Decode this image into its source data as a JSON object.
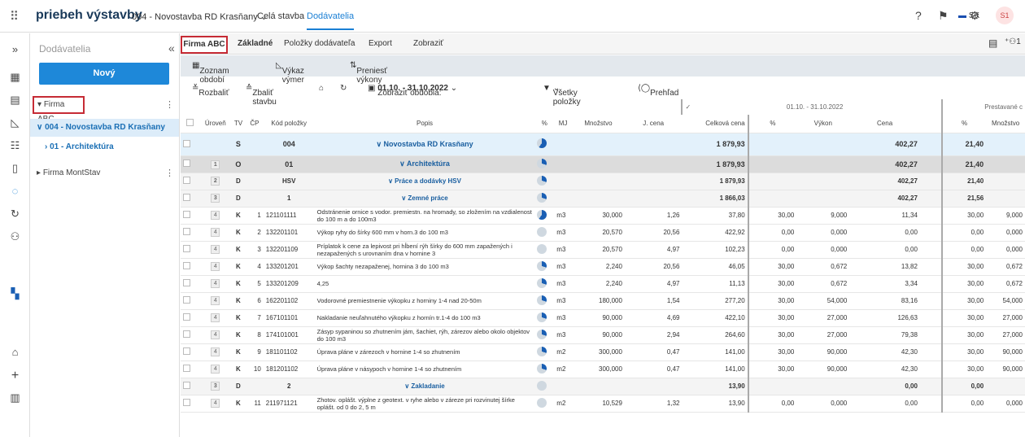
{
  "app": {
    "title": "priebeh výstavby",
    "project": "004 - Novostavba RD Krasňany",
    "nav": [
      "Celá stavba",
      "Dodávatelia"
    ],
    "lang": "SK",
    "user": "S1"
  },
  "sidebar": {
    "title": "Dodávatelia",
    "new_button": "Nový",
    "items": [
      {
        "label": "Firma ABC"
      },
      {
        "label": "004 - Novostavba RD Krasňany"
      },
      {
        "label": "01 - Architektúra"
      },
      {
        "label": "Firma MontStav"
      }
    ]
  },
  "tabs": {
    "firm": "Firma ABC",
    "items": [
      "Základné",
      "Položky dodávateľa",
      "Export",
      "Zobraziť"
    ]
  },
  "toolbar1": [
    "Zoznam období",
    "Výkaz výmer",
    "Preniesť výkony"
  ],
  "toolbar2": {
    "expand": "Rozbaliť",
    "collapse": "Zbaliť stavbu",
    "period_label": "Zobraziť obdobia: ",
    "period_value": "01.10. - 31.10.2022",
    "filter": "Všetky položky",
    "overview": "Prehľad"
  },
  "table": {
    "period_header": "01.10. - 31.10.2022",
    "prestavane_header": "Prestavané c",
    "columns": [
      "Úroveň",
      "TV",
      "ČP",
      "Kód položky",
      "Popis",
      "%",
      "MJ",
      "Množstvo",
      "J. cena",
      "Celková cena",
      "%",
      "Výkon",
      "Cena",
      "%",
      "Množstvo"
    ],
    "rows": [
      {
        "lvl": "",
        "tv": "S",
        "cp": "",
        "code": "004",
        "desc": "∨ Novostavba RD Krasňany",
        "pct": 60,
        "mj": "",
        "qty": "",
        "jc": "",
        "total": "1 879,93",
        "p2": "",
        "vykon": "",
        "cena": "402,27",
        "p3": "21,40",
        "mn": "",
        "cls": "rs"
      },
      {
        "lvl": "1",
        "tv": "O",
        "cp": "",
        "code": "01",
        "desc": "∨ Architektúra",
        "pct": 30,
        "mj": "",
        "qty": "",
        "jc": "",
        "total": "1 879,93",
        "p2": "",
        "vykon": "",
        "cena": "402,27",
        "p3": "21,40",
        "mn": "",
        "cls": "ro"
      },
      {
        "lvl": "2",
        "tv": "D",
        "cp": "",
        "code": "HSV",
        "desc": "∨ Práce a dodávky HSV",
        "pct": 30,
        "mj": "",
        "qty": "",
        "jc": "",
        "total": "1 879,93",
        "p2": "",
        "vykon": "",
        "cena": "402,27",
        "p3": "21,40",
        "mn": "",
        "cls": "rb"
      },
      {
        "lvl": "3",
        "tv": "D",
        "cp": "",
        "code": "1",
        "desc": "∨ Zemné práce",
        "pct": 30,
        "mj": "",
        "qty": "",
        "jc": "",
        "total": "1 866,03",
        "p2": "",
        "vykon": "",
        "cena": "402,27",
        "p3": "21,56",
        "mn": "",
        "cls": "rb"
      },
      {
        "lvl": "4",
        "tv": "K",
        "cp": "1",
        "code": "121101111",
        "desc": "Odstránenie ornice s vodor. premiestn. na hromady, so zložením na vzdialenost do 100 m a do 100m3",
        "pct": 60,
        "mj": "m3",
        "qty": "30,000",
        "jc": "1,26",
        "total": "37,80",
        "p2": "30,00",
        "vykon": "9,000",
        "cena": "11,34",
        "p3": "30,00",
        "mn": "9,000",
        "cls": ""
      },
      {
        "lvl": "4",
        "tv": "K",
        "cp": "2",
        "code": "132201101",
        "desc": "Výkop ryhy do šírky 600 mm v horn.3 do 100 m3",
        "pct": 0,
        "mj": "m3",
        "qty": "20,570",
        "jc": "20,56",
        "total": "422,92",
        "p2": "0,00",
        "vykon": "0,000",
        "cena": "0,00",
        "p3": "0,00",
        "mn": "0,000",
        "cls": ""
      },
      {
        "lvl": "4",
        "tv": "K",
        "cp": "3",
        "code": "132201109",
        "desc": "Príplatok k cene za lepivost pri hĺbení rýh šírky do 600 mm zapažených i nezapažených s urovnaním dna v hornine 3",
        "pct": 0,
        "mj": "m3",
        "qty": "20,570",
        "jc": "4,97",
        "total": "102,23",
        "p2": "0,00",
        "vykon": "0,000",
        "cena": "0,00",
        "p3": "0,00",
        "mn": "0,000",
        "cls": ""
      },
      {
        "lvl": "4",
        "tv": "K",
        "cp": "4",
        "code": "133201201",
        "desc": "Výkop šachty nezapaženej, hornina 3 do 100 m3",
        "pct": 30,
        "mj": "m3",
        "qty": "2,240",
        "jc": "20,56",
        "total": "46,05",
        "p2": "30,00",
        "vykon": "0,672",
        "cena": "13,82",
        "p3": "30,00",
        "mn": "0,672",
        "cls": ""
      },
      {
        "lvl": "4",
        "tv": "K",
        "cp": "5",
        "code": "133201209",
        "desc": "4,25",
        "pct": 30,
        "mj": "m3",
        "qty": "2,240",
        "jc": "4,97",
        "total": "11,13",
        "p2": "30,00",
        "vykon": "0,672",
        "cena": "3,34",
        "p3": "30,00",
        "mn": "0,672",
        "cls": ""
      },
      {
        "lvl": "4",
        "tv": "K",
        "cp": "6",
        "code": "162201102",
        "desc": "Vodorovné premiestnenie výkopku z horniny 1-4 nad 20-50m",
        "pct": 30,
        "mj": "m3",
        "qty": "180,000",
        "jc": "1,54",
        "total": "277,20",
        "p2": "30,00",
        "vykon": "54,000",
        "cena": "83,16",
        "p3": "30,00",
        "mn": "54,000",
        "cls": ""
      },
      {
        "lvl": "4",
        "tv": "K",
        "cp": "7",
        "code": "167101101",
        "desc": "Nakladanie neuľahnutého výkopku z hornín tr.1-4 do 100 m3",
        "pct": 30,
        "mj": "m3",
        "qty": "90,000",
        "jc": "4,69",
        "total": "422,10",
        "p2": "30,00",
        "vykon": "27,000",
        "cena": "126,63",
        "p3": "30,00",
        "mn": "27,000",
        "cls": ""
      },
      {
        "lvl": "4",
        "tv": "K",
        "cp": "8",
        "code": "174101001",
        "desc": "Zásyp sypaninou so zhutnením jám, šachiet, rýh, zárezov alebo okolo objektov do 100 m3",
        "pct": 30,
        "mj": "m3",
        "qty": "90,000",
        "jc": "2,94",
        "total": "264,60",
        "p2": "30,00",
        "vykon": "27,000",
        "cena": "79,38",
        "p3": "30,00",
        "mn": "27,000",
        "cls": ""
      },
      {
        "lvl": "4",
        "tv": "K",
        "cp": "9",
        "code": "181101102",
        "desc": "Úprava pláne v zárezoch v hornine 1-4 so zhutnením",
        "pct": 30,
        "mj": "m2",
        "qty": "300,000",
        "jc": "0,47",
        "total": "141,00",
        "p2": "30,00",
        "vykon": "90,000",
        "cena": "42,30",
        "p3": "30,00",
        "mn": "90,000",
        "cls": ""
      },
      {
        "lvl": "4",
        "tv": "K",
        "cp": "10",
        "code": "181201102",
        "desc": "Úprava pláne v násypoch v hornine 1-4 so zhutnením",
        "pct": 30,
        "mj": "m2",
        "qty": "300,000",
        "jc": "0,47",
        "total": "141,00",
        "p2": "30,00",
        "vykon": "90,000",
        "cena": "42,30",
        "p3": "30,00",
        "mn": "90,000",
        "cls": ""
      },
      {
        "lvl": "3",
        "tv": "D",
        "cp": "",
        "code": "2",
        "desc": "∨ Zakladanie",
        "pct": 0,
        "mj": "",
        "qty": "",
        "jc": "",
        "total": "13,90",
        "p2": "",
        "vykon": "",
        "cena": "0,00",
        "p3": "0,00",
        "mn": "",
        "cls": "rb"
      },
      {
        "lvl": "4",
        "tv": "K",
        "cp": "11",
        "code": "211971121",
        "desc": "Zhotov. oplášt. výplne z geotext. v ryhe alebo v zárezе pri rozvinutej šírke oplášt. od 0 do 2, 5 m",
        "pct": 0,
        "mj": "m2",
        "qty": "10,529",
        "jc": "1,32",
        "total": "13,90",
        "p2": "0,00",
        "vykon": "0,000",
        "cena": "0,00",
        "p3": "0,00",
        "mn": "0,000",
        "cls": ""
      }
    ]
  }
}
